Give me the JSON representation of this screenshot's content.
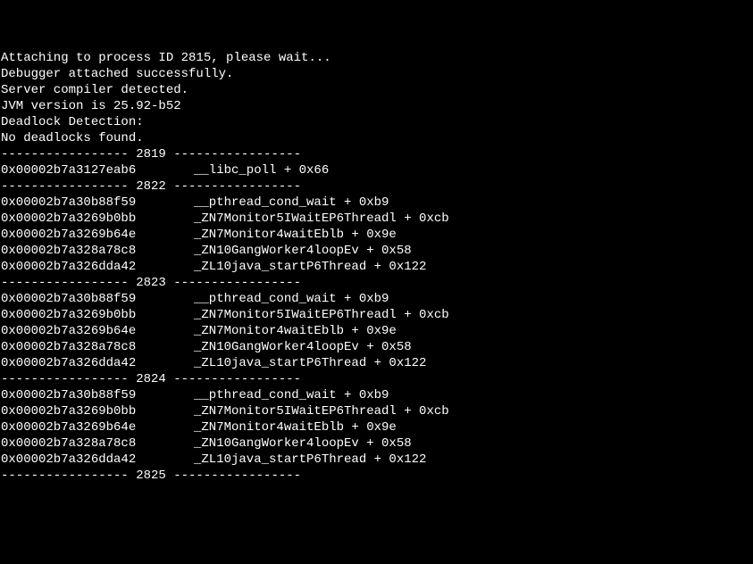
{
  "header": {
    "attach": "Attaching to process ID 2815, please wait...",
    "success": "Debugger attached successfully.",
    "compiler": "Server compiler detected.",
    "jvm": "JVM version is 25.92-b52",
    "deadlock_title": "Deadlock Detection:",
    "blank": "",
    "deadlock_result": "No deadlocks found."
  },
  "sep": {
    "left": "----------------- ",
    "right": " -----------------"
  },
  "threads": [
    {
      "id": "2819",
      "frames": [
        {
          "addr": "0x00002b7a3127eab6",
          "sym": "__libc_poll + 0x66"
        }
      ]
    },
    {
      "id": "2822",
      "frames": [
        {
          "addr": "0x00002b7a30b88f59",
          "sym": "__pthread_cond_wait + 0xb9"
        },
        {
          "addr": "0x00002b7a3269b0bb",
          "sym": "_ZN7Monitor5IWaitEP6Threadl + 0xcb"
        },
        {
          "addr": "0x00002b7a3269b64e",
          "sym": "_ZN7Monitor4waitEblb + 0x9e"
        },
        {
          "addr": "0x00002b7a328a78c8",
          "sym": "_ZN10GangWorker4loopEv + 0x58"
        },
        {
          "addr": "0x00002b7a326dda42",
          "sym": "_ZL10java_startP6Thread + 0x122"
        }
      ]
    },
    {
      "id": "2823",
      "frames": [
        {
          "addr": "0x00002b7a30b88f59",
          "sym": "__pthread_cond_wait + 0xb9"
        },
        {
          "addr": "0x00002b7a3269b0bb",
          "sym": "_ZN7Monitor5IWaitEP6Threadl + 0xcb"
        },
        {
          "addr": "0x00002b7a3269b64e",
          "sym": "_ZN7Monitor4waitEblb + 0x9e"
        },
        {
          "addr": "0x00002b7a328a78c8",
          "sym": "_ZN10GangWorker4loopEv + 0x58"
        },
        {
          "addr": "0x00002b7a326dda42",
          "sym": "_ZL10java_startP6Thread + 0x122"
        }
      ]
    },
    {
      "id": "2824",
      "frames": [
        {
          "addr": "0x00002b7a30b88f59",
          "sym": "__pthread_cond_wait + 0xb9"
        },
        {
          "addr": "0x00002b7a3269b0bb",
          "sym": "_ZN7Monitor5IWaitEP6Threadl + 0xcb"
        },
        {
          "addr": "0x00002b7a3269b64e",
          "sym": "_ZN7Monitor4waitEblb + 0x9e"
        },
        {
          "addr": "0x00002b7a328a78c8",
          "sym": "_ZN10GangWorker4loopEv + 0x58"
        },
        {
          "addr": "0x00002b7a326dda42",
          "sym": "_ZL10java_startP6Thread + 0x122"
        }
      ]
    },
    {
      "id": "2825",
      "frames": []
    }
  ]
}
